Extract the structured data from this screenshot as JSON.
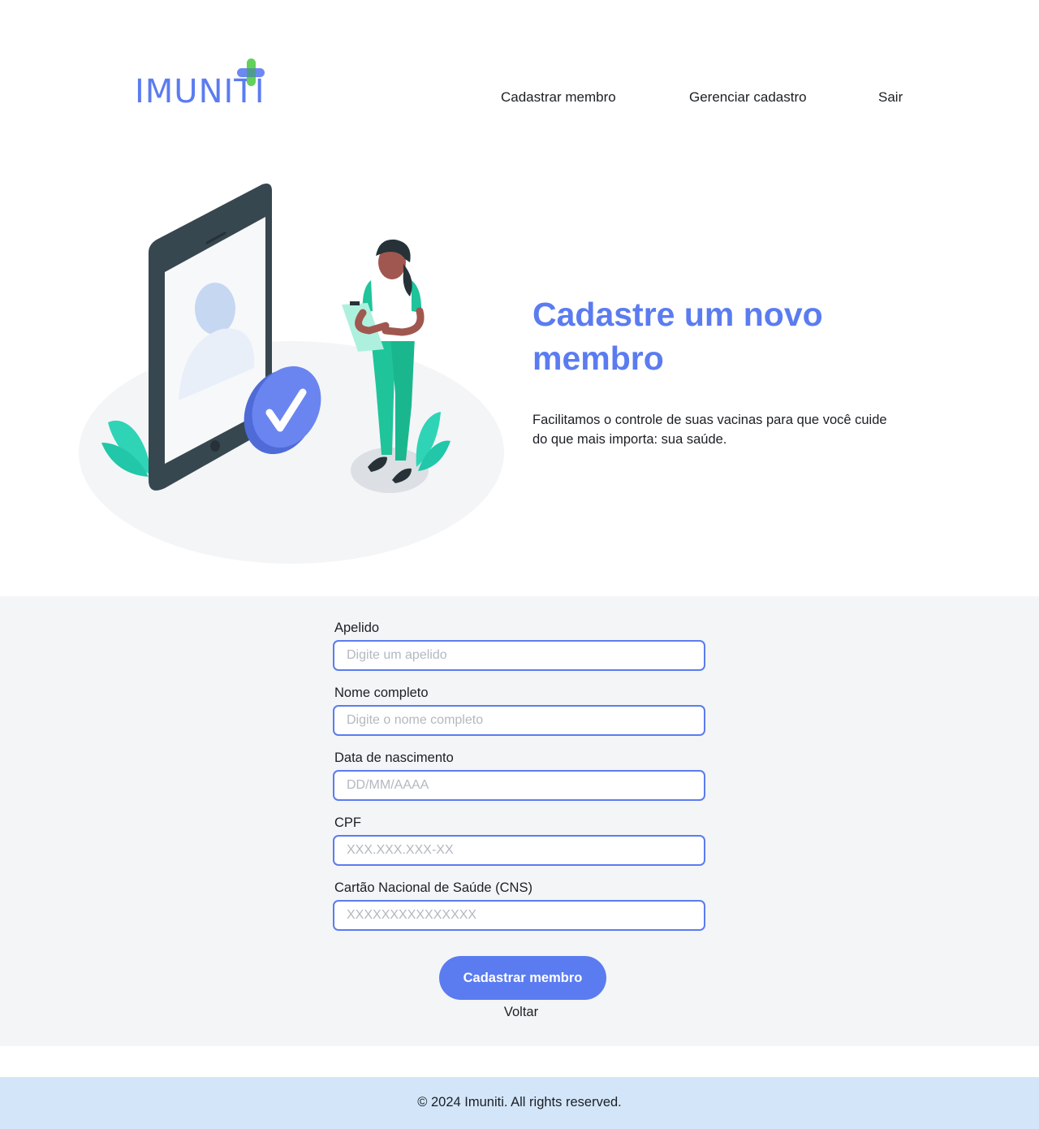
{
  "brand": {
    "name": "IMUNITI",
    "colors": {
      "primary": "#5b7cf0",
      "accent_green": "#63d05a",
      "footer_bg": "#d3e6f9",
      "section_bg": "#f4f5f7"
    }
  },
  "nav": {
    "items": [
      {
        "label": "Cadastrar membro"
      },
      {
        "label": "Gerenciar cadastro"
      },
      {
        "label": "Sair"
      }
    ]
  },
  "hero": {
    "title": "Cadastre um novo membro",
    "text": "Facilitamos o controle de suas vacinas para que você cuide do que mais importa: sua saúde.",
    "illustration": "phone-with-checkmark-and-woman-with-clipboard"
  },
  "form": {
    "fields": [
      {
        "label": "Apelido",
        "placeholder": "Digite um apelido",
        "value": ""
      },
      {
        "label": "Nome completo",
        "placeholder": "Digite o nome completo",
        "value": ""
      },
      {
        "label": "Data de nascimento",
        "placeholder": "DD/MM/AAAA",
        "value": ""
      },
      {
        "label": "CPF",
        "placeholder": "XXX.XXX.XXX-XX",
        "value": ""
      },
      {
        "label": "Cartão Nacional de Saúde (CNS)",
        "placeholder": "XXXXXXXXXXXXXXX",
        "value": ""
      }
    ],
    "submit_label": "Cadastrar membro",
    "back_label": "Voltar"
  },
  "footer": {
    "text": "© 2024 Imuniti. All rights reserved."
  }
}
